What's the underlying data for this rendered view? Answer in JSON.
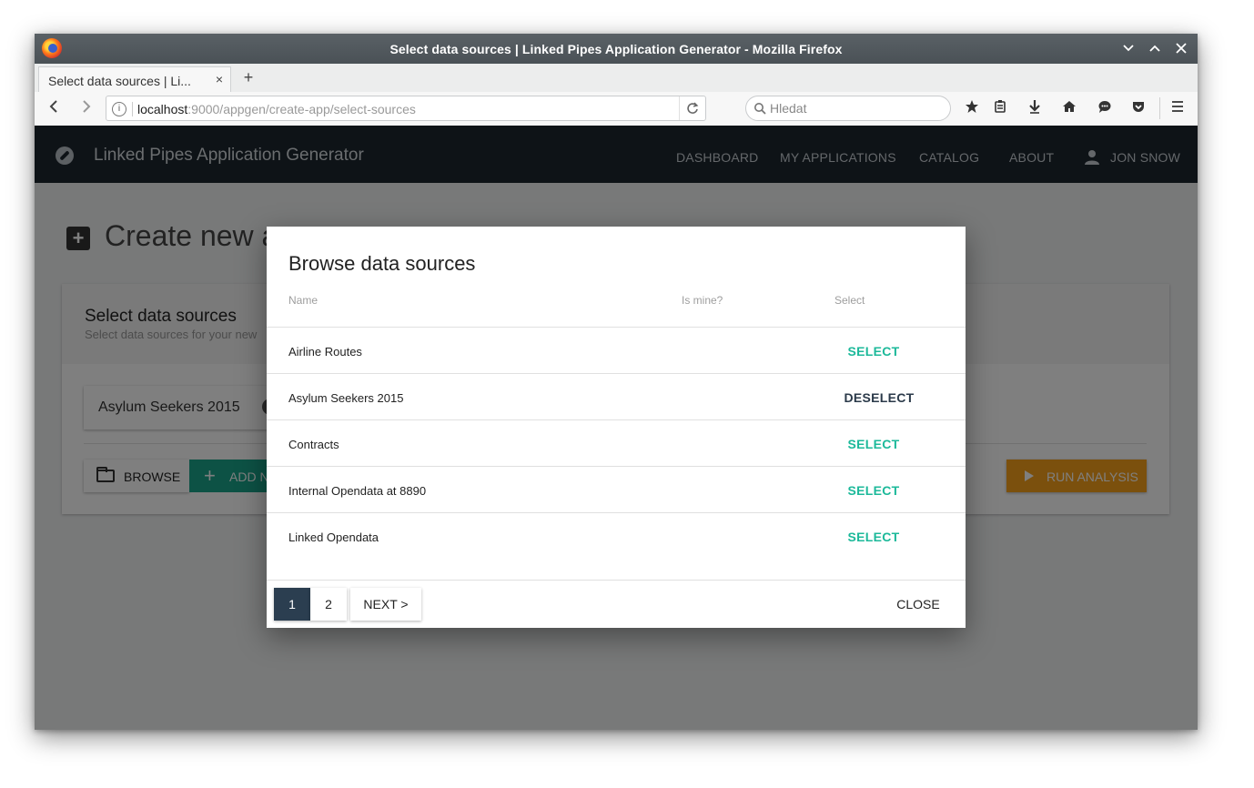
{
  "window": {
    "title": "Select data sources | Linked Pipes Application Generator - Mozilla Firefox"
  },
  "tab": {
    "label": "Select data sources | Li...",
    "close": "×",
    "new_tab": "+"
  },
  "urlbar": {
    "host": "localhost",
    "rest": ":9000/appgen/create-app/select-sources"
  },
  "search": {
    "placeholder": "Hledat"
  },
  "app": {
    "title": "Linked Pipes Application Generator",
    "nav": {
      "dashboard": "DASHBOARD",
      "my_applications": "MY APPLICATIONS",
      "catalog": "CATALOG",
      "about": "ABOUT",
      "user": "JON SNOW"
    }
  },
  "page": {
    "title": "Create new a",
    "card_title": "Select data sources",
    "card_subtitle": "Select data sources for your new",
    "chip_label": "Asylum Seekers 2015",
    "browse": "BROWSE",
    "add_new": "ADD N",
    "run_analysis": "RUN ANALYSIS"
  },
  "dialog": {
    "title": "Browse data sources",
    "columns": {
      "name": "Name",
      "is_mine": "Is mine?",
      "select": "Select"
    },
    "rows": [
      {
        "name": "Airline Routes",
        "action": "SELECT"
      },
      {
        "name": "Asylum Seekers 2015",
        "action": "DESELECT"
      },
      {
        "name": "Contracts",
        "action": "SELECT"
      },
      {
        "name": "Internal Opendata at 8890",
        "action": "SELECT"
      },
      {
        "name": "Linked Opendata",
        "action": "SELECT"
      }
    ],
    "pages": [
      "1",
      "2"
    ],
    "next": "NEXT >",
    "close": "CLOSE"
  },
  "colors": {
    "header_bg": "#1c262f",
    "accent_green": "#1cb99a",
    "run_orange": "#f6a01a",
    "active_page": "#2b3e50"
  }
}
